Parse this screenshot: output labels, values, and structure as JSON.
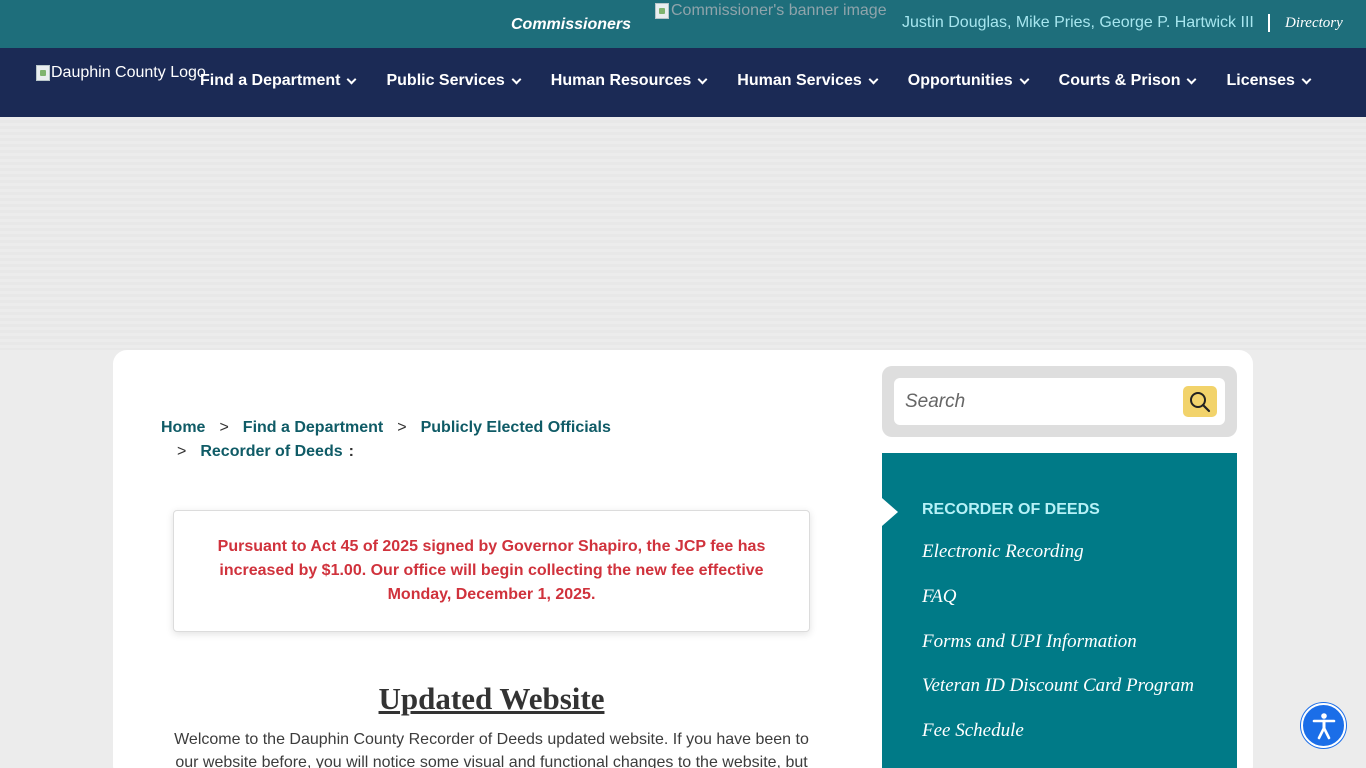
{
  "topbar": {
    "commissioners_label": "Commissioners",
    "banner_alt": "Commissioner's banner image",
    "commissioner_names": "Justin Douglas, Mike Pries, George P. Hartwick III",
    "directory_label": "Directory"
  },
  "nav": {
    "logo_alt": "Dauphin County Logo",
    "items": [
      {
        "label": "Find a Department"
      },
      {
        "label": "Public Services"
      },
      {
        "label": "Human Resources"
      },
      {
        "label": "Human Services"
      },
      {
        "label": "Opportunities"
      },
      {
        "label": "Courts & Prison"
      },
      {
        "label": "Licenses"
      }
    ]
  },
  "breadcrumb": {
    "items": [
      "Home",
      "Find a Department",
      "Publicly Elected Officials",
      "Recorder of Deeds"
    ],
    "separator": ">",
    "trailing": ":"
  },
  "notice": {
    "text": "Pursuant to Act 45 of 2025 signed by Governor Shapiro, the JCP fee has increased by $1.00.  Our office will begin collecting the new fee effective Monday, December 1, 2025."
  },
  "content": {
    "title": "Updated Website",
    "welcome": "Welcome to the Dauphin County Recorder of Deeds updated website. If you have been to our website before, you will notice some visual and functional changes to the website, but"
  },
  "search": {
    "placeholder": "Search"
  },
  "sidebar": {
    "heading": "RECORDER OF DEEDS",
    "links": [
      {
        "label": "Electronic Recording"
      },
      {
        "label": "FAQ"
      },
      {
        "label": "Forms and UPI Information"
      },
      {
        "label": "Veteran ID Discount Card Program"
      },
      {
        "label": "Fee Schedule"
      }
    ]
  },
  "colors": {
    "topbar": "#1e6e7b",
    "nav": "#1b2a55",
    "sidebar": "#007a87",
    "notice_text": "#d0323c",
    "search_button": "#f2d36b",
    "accessibility_button": "#1b6ee8"
  }
}
